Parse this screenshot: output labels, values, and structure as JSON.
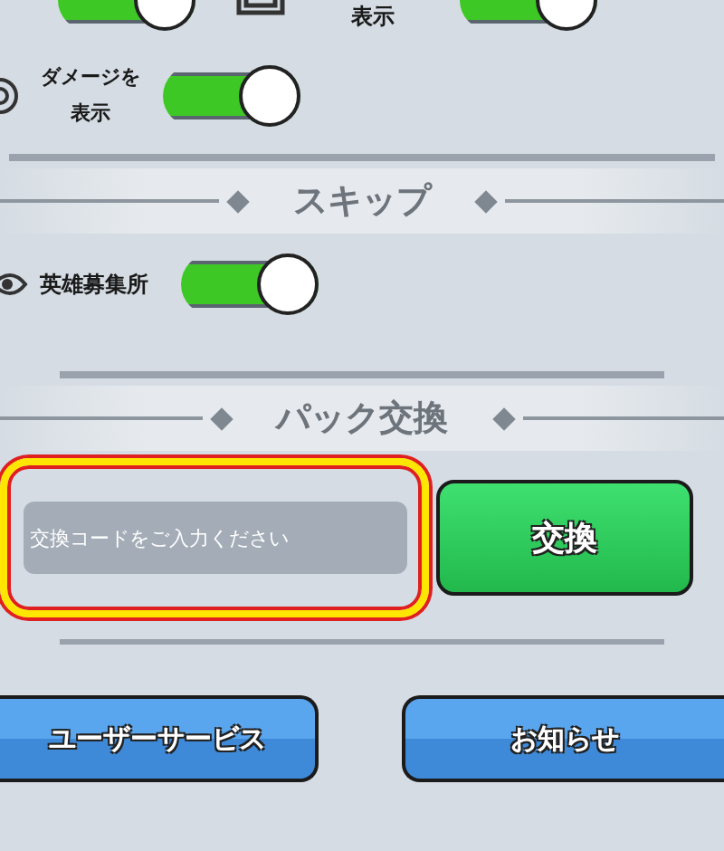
{
  "top_row": {
    "left_toggle": {
      "on": true
    },
    "right_label": "表示",
    "right_toggle": {
      "on": true
    }
  },
  "display_settings": [
    {
      "label": "ダメージを表示",
      "on": true
    }
  ],
  "skip_section": {
    "title": "スキップ",
    "items": [
      {
        "label": "英雄募集所",
        "on": true
      }
    ]
  },
  "pack_exchange": {
    "title": "パック交換",
    "code_field": {
      "placeholder": "交換コードをご入力ください",
      "highlighted": true
    },
    "exchange_button": "交換"
  },
  "footer_buttons": [
    "ユーザーサービス",
    "お知らせ"
  ]
}
